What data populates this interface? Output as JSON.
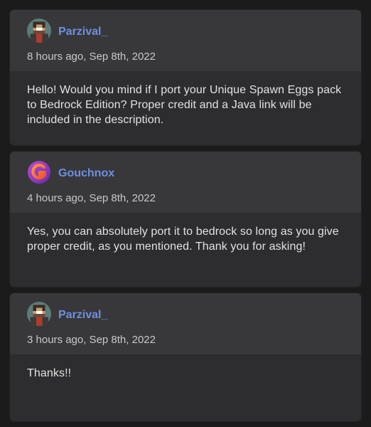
{
  "comments": [
    {
      "author": "Parzival_",
      "avatar_icon": "pixel-skin-avatar-icon",
      "time": "8 hours ago, Sep 8th, 2022",
      "text": "Hello! Would you mind if I port your Unique Spawn Eggs pack to Bedrock Edition? Proper credit and a Java link will be included in the description."
    },
    {
      "author": "Gouchnox",
      "avatar_icon": "g-logo-avatar-icon",
      "time": "4 hours ago, Sep 8th, 2022",
      "text": "Yes, you can absolutely port it to bedrock so long as you give proper credit, as you mentioned. Thank you for asking!"
    },
    {
      "author": "Parzival_",
      "avatar_icon": "pixel-skin-avatar-icon",
      "time": "3 hours ago, Sep 8th, 2022",
      "text": "Thanks!!"
    }
  ],
  "colors": {
    "background": "#1b1b1c",
    "card_header": "#38383b",
    "card_body": "#2d2d30",
    "username": "#6f8fe0",
    "text": "#e2e2e2"
  }
}
